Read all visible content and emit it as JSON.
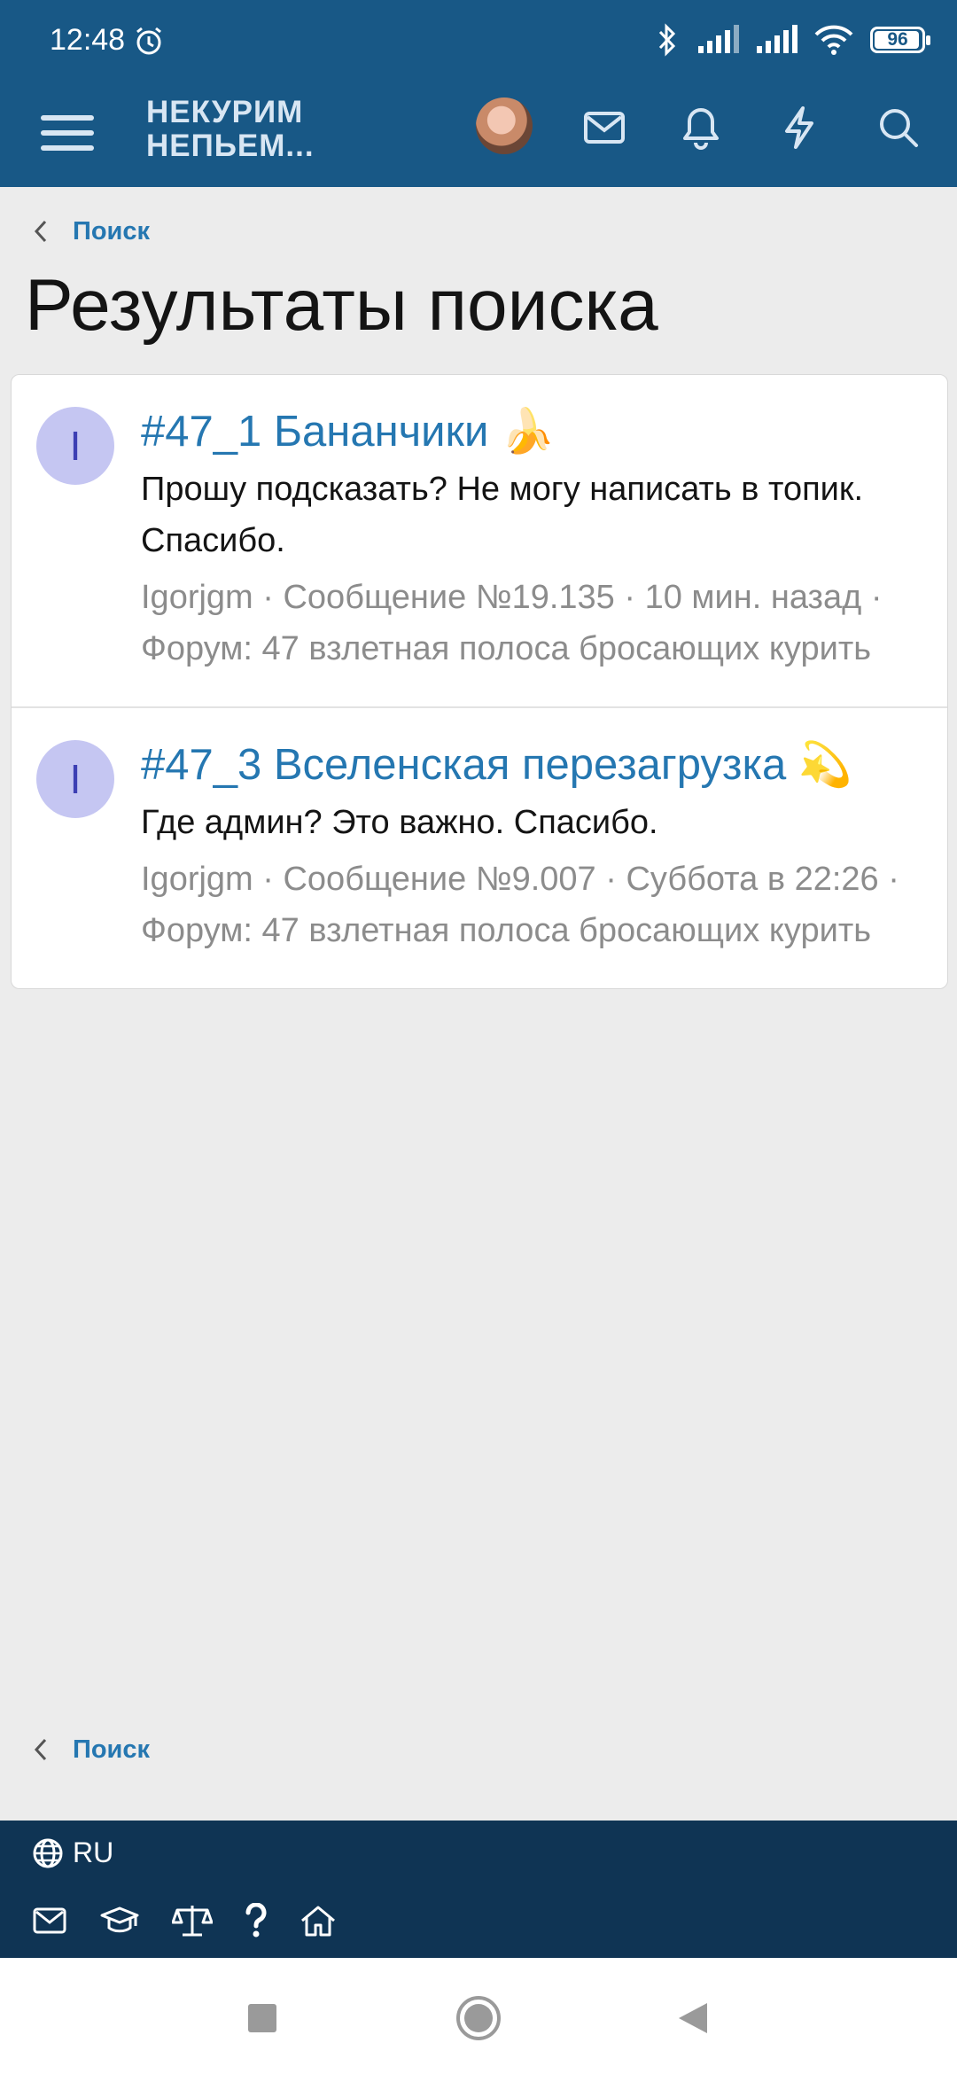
{
  "status_bar": {
    "time": "12:48",
    "battery": "96"
  },
  "app_bar": {
    "logo_line1": "НЕКУРИМ",
    "logo_line2": "НЕПЬЕМ..."
  },
  "breadcrumb": {
    "label": "Поиск"
  },
  "page": {
    "title": "Результаты поиска"
  },
  "results": [
    {
      "avatar_letter": "I",
      "title": "#47_1 Бананчики 🍌",
      "snippet": "Прошу подсказать? Не могу написать в топик. Спасибо.",
      "meta": "Igorjgm · Сообщение №19.135 · 10 мин. назад · Форум: 47 взлетная полоса бросающих курить"
    },
    {
      "avatar_letter": "I",
      "title": "#47_3 Вселенская перезагрузка 💫",
      "snippet": "Где админ? Это важно. Спасибо.",
      "meta": "Igorjgm · Сообщение №9.007 · Суббота в 22:26 · Форум: 47 взлетная полоса бросающих курить"
    }
  ],
  "footer": {
    "language": "RU"
  },
  "colors": {
    "header": "#185886",
    "footer": "#0f3454",
    "link": "#2577b1",
    "meta": "#8c8c8c"
  },
  "icons": [
    "alarm-icon",
    "bluetooth-icon",
    "signal-icon",
    "wifi-icon",
    "battery-icon",
    "menu-icon",
    "avatar",
    "mail-icon",
    "bell-icon",
    "bolt-icon",
    "search-icon",
    "chevron-left-icon",
    "globe-icon",
    "graduation-cap-icon",
    "scales-icon",
    "question-icon",
    "home-icon",
    "nav-square-icon",
    "nav-circle-icon",
    "nav-back-icon"
  ]
}
